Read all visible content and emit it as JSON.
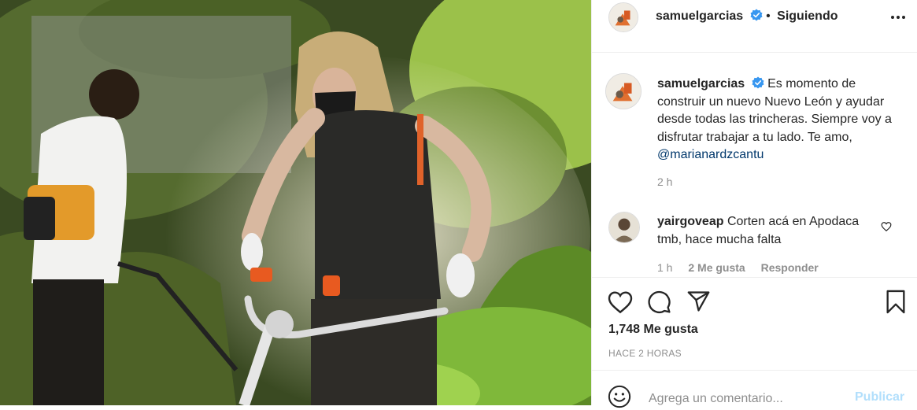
{
  "post": {
    "username": "samuelgarcias",
    "follow_separator": "•",
    "follow_label": "Siguiendo"
  },
  "caption": {
    "username": "samuelgarcias",
    "text": "Es momento de construir un nuevo Nuevo León y ayudar desde todas las trincheras. Siempre voy a disfrutar trabajar a tu lado. Te amo,",
    "mention": "@marianardzcantu",
    "time": "2 h"
  },
  "comment": {
    "username": "yairgoveap",
    "text": "Corten acá en Apodaca tmb, hace mucha falta",
    "time": "1 h",
    "likes": "2 Me gusta",
    "reply_label": "Responder"
  },
  "actions": {
    "icons": [
      "heart-icon",
      "comment-icon",
      "share-icon",
      "bookmark-icon"
    ],
    "likes": "1,748 Me gusta",
    "posted": "HACE 2 HORAS"
  },
  "add_comment": {
    "placeholder": "Agrega un comentario...",
    "publish_label": "Publicar"
  },
  "colors": {
    "verified": "#3897f0",
    "link": "#00376b",
    "publish_disabled": "#b2dffc",
    "secondary_text": "#8e8e8e"
  }
}
